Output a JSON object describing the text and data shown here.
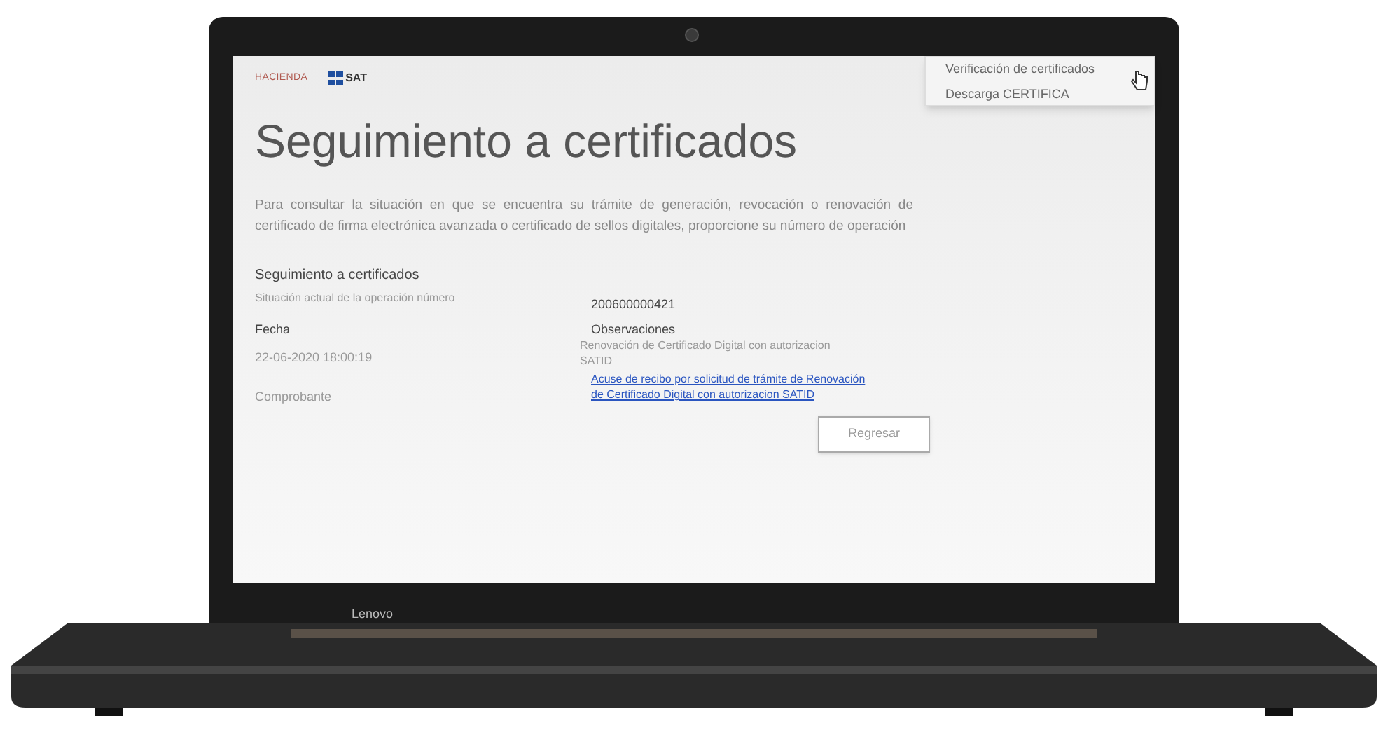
{
  "header": {
    "logos": [
      "HACIENDA",
      "SAT"
    ]
  },
  "menu": [
    {
      "label": "Verificación de certificados"
    },
    {
      "label": "Descarga CERTIFICA"
    }
  ],
  "title": "Seguimiento a certificados",
  "intro": "Para consultar la situación en que se encuentra su trámite de generación, revocación o renovación de certificado de firma electrónica avanzada o certificado de sellos digitales, proporcione su número de operación",
  "section": {
    "heading": "Seguimiento a certificados",
    "operation_label": "Situación actual de la operación número",
    "operation_number": "200600000421",
    "fecha_label": "Fecha",
    "fecha": "22-06-2020 18:00:19",
    "observaciones_label": "Observaciones",
    "observacion": "Renovación de Certificado Digital con autorizacion SATID",
    "comprobante_label": "Comprobante",
    "comprobante_link": "Acuse de recibo por solicitud de trámite de Renovación de Certificado Digital con autorizacion SATID"
  },
  "buttons": [
    {
      "label": "Regresar"
    }
  ],
  "laptop": {
    "brand": "Lenovo"
  }
}
